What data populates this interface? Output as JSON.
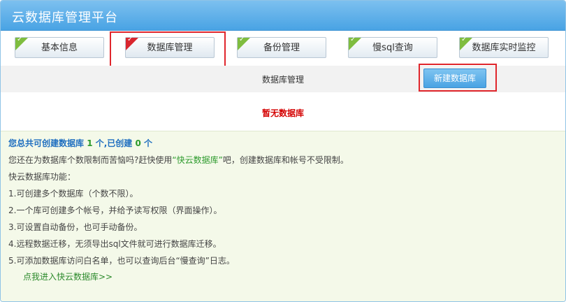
{
  "window": {
    "title": "云数据库管理平台"
  },
  "tabs": [
    {
      "label": "基本信息",
      "active": false
    },
    {
      "label": "数据库管理",
      "active": true
    },
    {
      "label": "备份管理",
      "active": false
    },
    {
      "label": "慢sql查询",
      "active": false
    },
    {
      "label": "数据库实时监控",
      "active": false
    }
  ],
  "subbar": {
    "label": "数据库管理",
    "new_button": "新建数据库"
  },
  "empty_message": "暂无数据库",
  "info": {
    "quota_prefix": "您总共可创建数据库",
    "quota_total": "1",
    "quota_mid": "个,已创建",
    "quota_created": "0",
    "quota_suffix": "个",
    "promo_prefix": "您还在为数据库个数限制而苦恼吗?赶快使用",
    "promo_product": "“快云数据库”",
    "promo_suffix": "吧，创建数据库和帐号不受限制。",
    "features_title": "快云数据库功能：",
    "features": [
      "1.可创建多个数据库（个数不限）。",
      "2.一个库可创建多个帐号，并给予读写权限（界面操作）。",
      "3.可设置自动备份，也可手动备份。",
      "4.远程数据迁移，无须导出sql文件就可进行数据库迁移。",
      "5.可添加数据库访问白名单，也可以查询后台“慢查询”日志。"
    ],
    "link": "点我进入快云数据库>>"
  },
  "colors": {
    "titlebar": "#49a3e4",
    "tab_corner_done": "#7fbd3f",
    "tab_corner_active": "#d9262e",
    "highlight": "#e0262c",
    "empty_text": "#d40000",
    "info_bg": "#f4f9e9"
  },
  "icons": {
    "tab_check": "check-icon"
  }
}
